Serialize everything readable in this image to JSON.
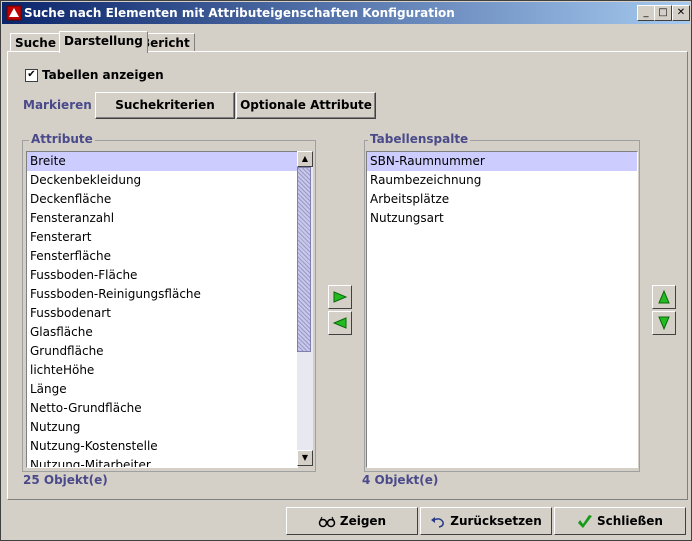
{
  "window": {
    "title": "Suche nach Elementen mit Attributeigenschaften Konfiguration",
    "controls": {
      "minimize": "_",
      "maximize": "□",
      "close": "✕"
    }
  },
  "tabs": [
    {
      "label": "Suche"
    },
    {
      "label": "Darstellung",
      "active": true
    },
    {
      "label": "Bericht"
    }
  ],
  "options": {
    "show_tables_label": "Tabellen anzeigen",
    "show_tables_checked": true
  },
  "markieren": {
    "label": "Markieren :",
    "buttons": [
      "Suchekriterien",
      "Optionale Attribute"
    ]
  },
  "attribute_panel": {
    "title": "Attribute",
    "items": [
      "Breite",
      "Deckenbekleidung",
      "Deckenfläche",
      "Fensteranzahl",
      "Fensterart",
      "Fensterfläche",
      "Fussboden-Fläche",
      "Fussboden-Reinigungsfläche",
      "Fussbodenart",
      "Glasfläche",
      "Grundfläche",
      "lichteHöhe",
      "Länge",
      "Netto-Grundfläche",
      "Nutzung",
      "Nutzung-Kostenstelle",
      "Nutzung-Mitarbeiter"
    ],
    "selected_index": 0,
    "count": "25 Objekt(e)"
  },
  "table_column_panel": {
    "title": "Tabellenspalte",
    "items": [
      "SBN-Raumnummer",
      "Raumbezeichnung",
      "Arbeitsplätze",
      "Nutzungsart"
    ],
    "selected_index": 0,
    "count": "4 Objekt(e)"
  },
  "footer": {
    "show_label": "Zeigen",
    "reset_label": "Zurücksetzen",
    "close_label": "Schließen"
  },
  "colors": {
    "accent_text": "#4a4a8a",
    "selection": "#ccccff",
    "arrow_green": "#22bb22"
  }
}
